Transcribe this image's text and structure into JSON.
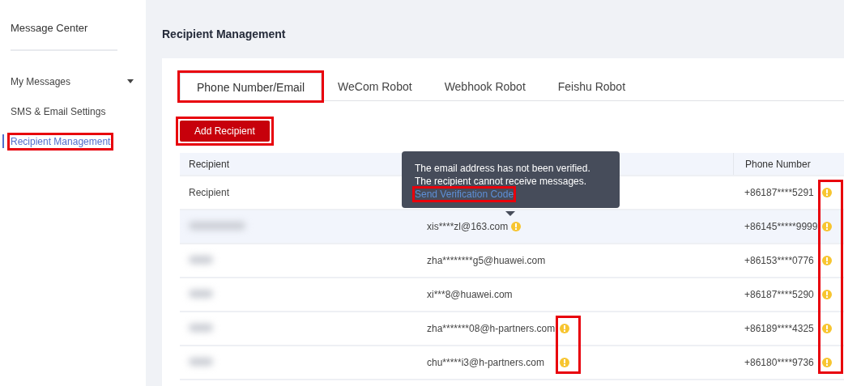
{
  "sidebar": {
    "title": "Message Center",
    "items": [
      {
        "label": "My Messages",
        "selected": false,
        "expandable": true,
        "outlined": false
      },
      {
        "label": "SMS & Email Settings",
        "selected": false,
        "expandable": false,
        "outlined": false
      },
      {
        "label": "Recipient Management",
        "selected": true,
        "expandable": false,
        "outlined": true
      }
    ]
  },
  "page_title": "Recipient Management",
  "tabs": [
    {
      "label": "Phone Number/Email",
      "selected": true,
      "outlined": true
    },
    {
      "label": "WeCom Robot",
      "selected": false,
      "outlined": false
    },
    {
      "label": "Webhook Robot",
      "selected": false,
      "outlined": false
    },
    {
      "label": "Feishu Robot",
      "selected": false,
      "outlined": false
    }
  ],
  "add_button": {
    "label": "Add Recipient",
    "outlined": true
  },
  "table": {
    "columns": [
      "Recipient",
      "Phone Number"
    ],
    "rows": [
      {
        "name": "Recipient",
        "redacted": false,
        "hovered": false,
        "phone": "+86187****5291",
        "phone_warning": true,
        "phone_mark_outlined": true
      },
      {
        "redacted": true,
        "hovered": true,
        "email": "xis****zl@163.com",
        "email_warning": true,
        "email_mark_outlined": false,
        "phone": "+86145*****9999",
        "phone_warning": true,
        "phone_mark_outlined": true
      },
      {
        "redacted": true,
        "hovered": false,
        "email": "zha********g5@huawei.com",
        "email_warning": false,
        "phone": "+86153****0776",
        "phone_warning": true,
        "phone_mark_outlined": true
      },
      {
        "redacted": true,
        "hovered": false,
        "email": "xi***8@huawei.com",
        "email_warning": false,
        "phone": "+86187****5290",
        "phone_warning": true,
        "phone_mark_outlined": true
      },
      {
        "redacted": true,
        "hovered": false,
        "email": "zha*******08@h-partners.com",
        "email_warning": true,
        "email_mark_outlined": true,
        "phone": "+86189****4325",
        "phone_warning": true,
        "phone_mark_outlined": true
      },
      {
        "redacted": true,
        "hovered": false,
        "email": "chu*****i3@h-partners.com",
        "email_warning": true,
        "email_mark_outlined": true,
        "phone": "+86180****9736",
        "phone_warning": true,
        "phone_mark_outlined": true
      }
    ]
  },
  "tooltip": {
    "lines": [
      "The email address has not been verified.",
      "The recipient cannot receive messages."
    ],
    "link": "Send Verification Code",
    "link_outlined": true
  }
}
